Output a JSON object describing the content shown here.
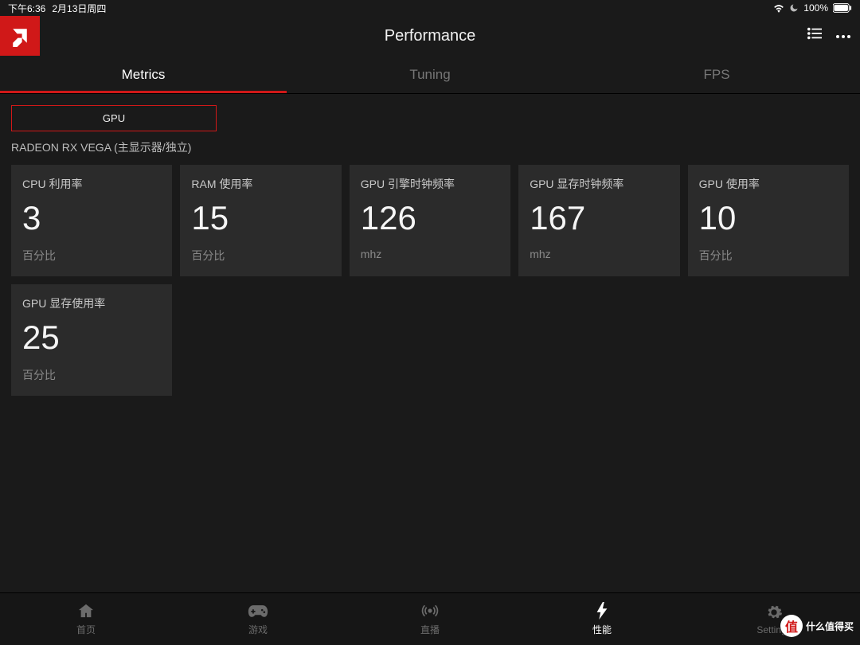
{
  "status": {
    "time": "下午6:36",
    "date": "2月13日周四",
    "battery": "100%"
  },
  "header": {
    "title": "Performance"
  },
  "tabs": [
    {
      "label": "Metrics",
      "active": true
    },
    {
      "label": "Tuning",
      "active": false
    },
    {
      "label": "FPS",
      "active": false
    }
  ],
  "chip": {
    "label": "GPU"
  },
  "device_label": "RADEON RX VEGA (主显示器/独立)",
  "metrics": [
    {
      "title": "CPU 利用率",
      "value": "3",
      "unit": "百分比"
    },
    {
      "title": "RAM 使用率",
      "value": "15",
      "unit": "百分比"
    },
    {
      "title": "GPU 引擎时钟频率",
      "value": "126",
      "unit": "mhz"
    },
    {
      "title": "GPU 显存时钟频率",
      "value": "167",
      "unit": "mhz"
    },
    {
      "title": "GPU 使用率",
      "value": "10",
      "unit": "百分比"
    },
    {
      "title": "GPU 显存使用率",
      "value": "25",
      "unit": "百分比"
    }
  ],
  "nav": [
    {
      "label": "首页",
      "icon": "home-icon",
      "active": false
    },
    {
      "label": "游戏",
      "icon": "gamepad-icon",
      "active": false
    },
    {
      "label": "直播",
      "icon": "broadcast-icon",
      "active": false
    },
    {
      "label": "性能",
      "icon": "bolt-icon",
      "active": true
    },
    {
      "label": "Settings",
      "icon": "gear-icon",
      "active": false
    }
  ],
  "watermark": {
    "badge": "值",
    "text": "什么值得买"
  },
  "colors": {
    "accent": "#d01818",
    "card_bg": "#2b2b2b",
    "bg": "#1a1a1a"
  }
}
